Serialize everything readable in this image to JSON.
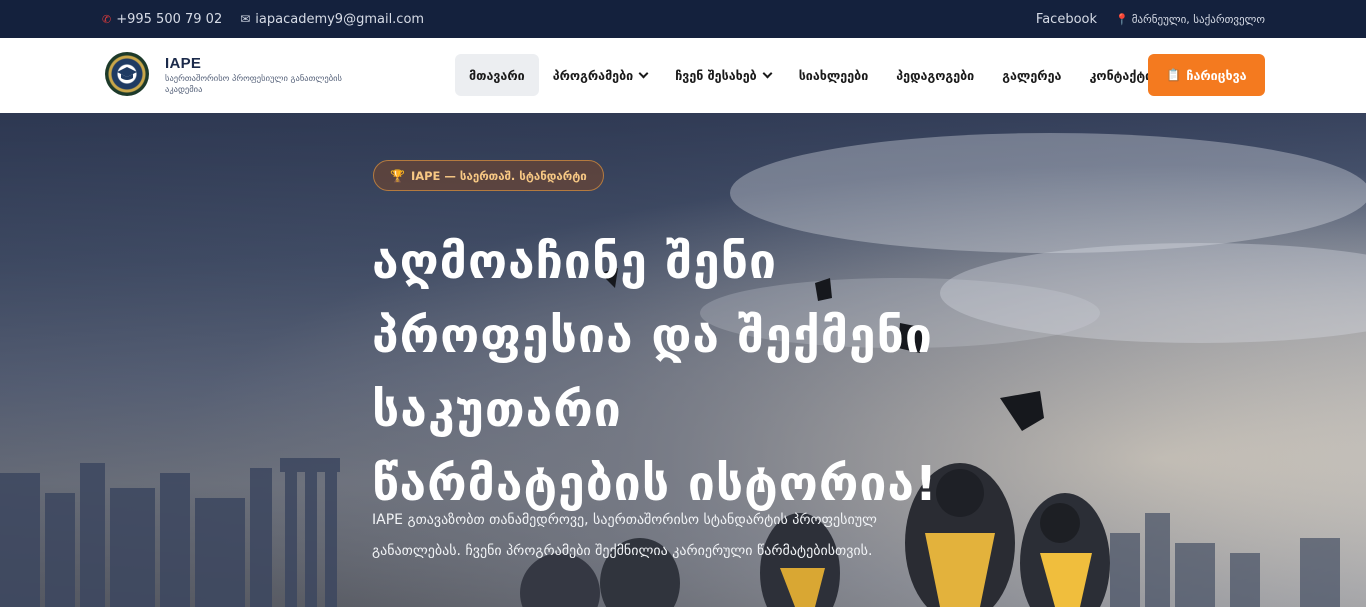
{
  "topbar": {
    "phone": "+995 500 79 02",
    "email": "iapacademy9@gmail.com",
    "facebook": "Facebook",
    "location": "მარნეული, საქართველო"
  },
  "header": {
    "brand_name": "IAPE",
    "brand_subtitle": "საერთაშორისო პროფესიული განათლების აკადემია",
    "nav": [
      {
        "label": "მთავარი",
        "active": true
      },
      {
        "label": "პროგრამები",
        "dropdown": true
      },
      {
        "label": "ჩვენ შესახებ",
        "dropdown": true
      },
      {
        "label": "სიახლეები"
      },
      {
        "label": "პედაგოგები"
      },
      {
        "label": "გალერეა"
      },
      {
        "label": "კონტაქტი"
      }
    ],
    "cta_label": "ჩარიცხვა"
  },
  "hero": {
    "badge": "IAPE — საერთაშ. სტანდარტი",
    "headline_lines": [
      "აღმოაჩინე შენი",
      "პროფესია და შექმენი",
      "საკუთარი",
      "წარმატების ისტორია!"
    ],
    "description": "IAPE გთავაზობთ თანამედროვე, საერთაშორისო სტანდარტის პროფესიულ განათლებას. ჩვენი პროგრამები შექმნილია კარიერული წარმატებისთვის."
  },
  "colors": {
    "topbar_bg": "#14213d",
    "cta_bg": "#f47a1f",
    "badge_text": "#f7c884"
  },
  "icons": {
    "phone": "phone-icon",
    "email": "mail-icon",
    "location": "pin-icon",
    "cta": "clipboard-icon",
    "badge": "trophy-icon"
  }
}
